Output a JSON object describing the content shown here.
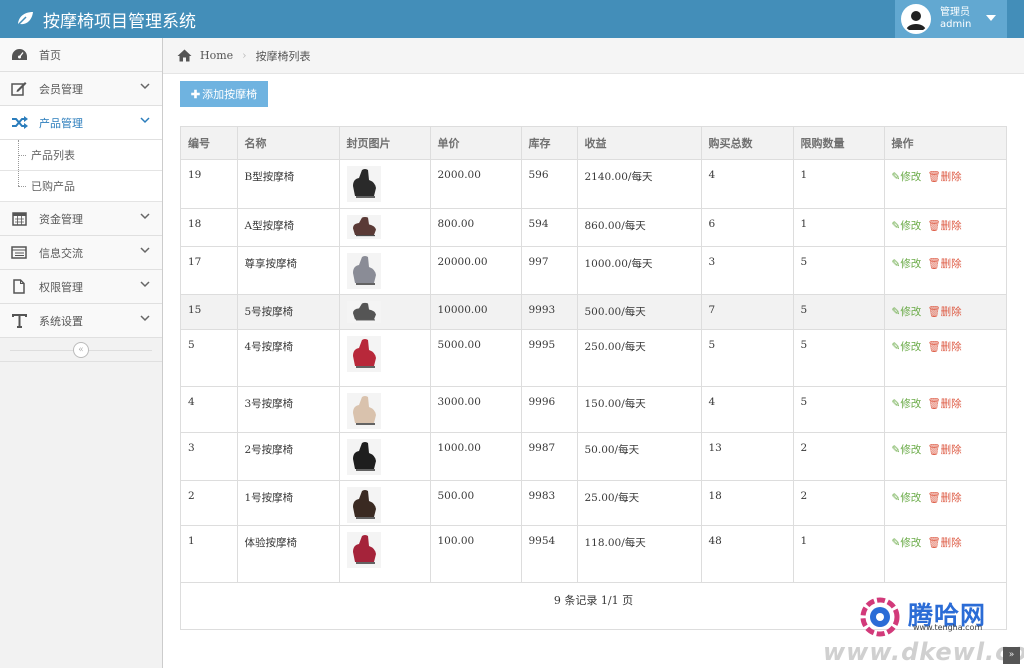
{
  "app": {
    "title": "按摩椅项目管理系统"
  },
  "user": {
    "role": "管理员",
    "name": "admin"
  },
  "sidebar": {
    "items": [
      {
        "label": "首页",
        "icon": "dashboard-icon"
      },
      {
        "label": "会员管理",
        "icon": "edit-icon"
      },
      {
        "label": "产品管理",
        "icon": "random-icon"
      },
      {
        "label": "资金管理",
        "icon": "calendar-icon"
      },
      {
        "label": "信息交流",
        "icon": "list-icon"
      },
      {
        "label": "权限管理",
        "icon": "file-icon"
      },
      {
        "label": "系统设置",
        "icon": "text-icon"
      }
    ],
    "sub_items": [
      {
        "label": "产品列表"
      },
      {
        "label": "已购产品"
      }
    ]
  },
  "breadcrumb": {
    "home": "Home",
    "current": "按摩椅列表"
  },
  "toolbar": {
    "add_label": "添加按摩椅"
  },
  "table": {
    "headers": [
      "编号",
      "名称",
      "封页图片",
      "单价",
      "库存",
      "收益",
      "购买总数",
      "限购数量",
      "操作"
    ],
    "rows": [
      {
        "id": "19",
        "name": "B型按摩椅",
        "price": "2000.00",
        "stock": "596",
        "income": "2140.00/每天",
        "total": "4",
        "limit": "1",
        "chair_color": "#2a2a2a"
      },
      {
        "id": "18",
        "name": "A型按摩椅",
        "price": "800.00",
        "stock": "594",
        "income": "860.00/每天",
        "total": "6",
        "limit": "1",
        "chair_color": "#5a3a36"
      },
      {
        "id": "17",
        "name": "尊享按摩椅",
        "price": "20000.00",
        "stock": "997",
        "income": "1000.00/每天",
        "total": "3",
        "limit": "5",
        "chair_color": "#8a8c96"
      },
      {
        "id": "15",
        "name": "5号按摩椅",
        "price": "10000.00",
        "stock": "9993",
        "income": "500.00/每天",
        "total": "7",
        "limit": "5",
        "chair_color": "#555555"
      },
      {
        "id": "5",
        "name": "4号按摩椅",
        "price": "5000.00",
        "stock": "9995",
        "income": "250.00/每天",
        "total": "5",
        "limit": "5",
        "chair_color": "#b8283a"
      },
      {
        "id": "4",
        "name": "3号按摩椅",
        "price": "3000.00",
        "stock": "9996",
        "income": "150.00/每天",
        "total": "4",
        "limit": "5",
        "chair_color": "#d9c2ad"
      },
      {
        "id": "3",
        "name": "2号按摩椅",
        "price": "1000.00",
        "stock": "9987",
        "income": "50.00/每天",
        "total": "13",
        "limit": "2",
        "chair_color": "#1e1e1e"
      },
      {
        "id": "2",
        "name": "1号按摩椅",
        "price": "500.00",
        "stock": "9983",
        "income": "25.00/每天",
        "total": "18",
        "limit": "2",
        "chair_color": "#3a2a22"
      },
      {
        "id": "1",
        "name": "体验按摩椅",
        "price": "100.00",
        "stock": "9954",
        "income": "118.00/每天",
        "total": "48",
        "limit": "1",
        "chair_color": "#a5233a"
      }
    ],
    "edit_label": "修改",
    "delete_label": "删除",
    "footer": "9 条记录 1/1 页"
  },
  "watermark": {
    "brand": "腾哈网",
    "site": "www.tengha.com",
    "url": "www.dkewl.com"
  }
}
